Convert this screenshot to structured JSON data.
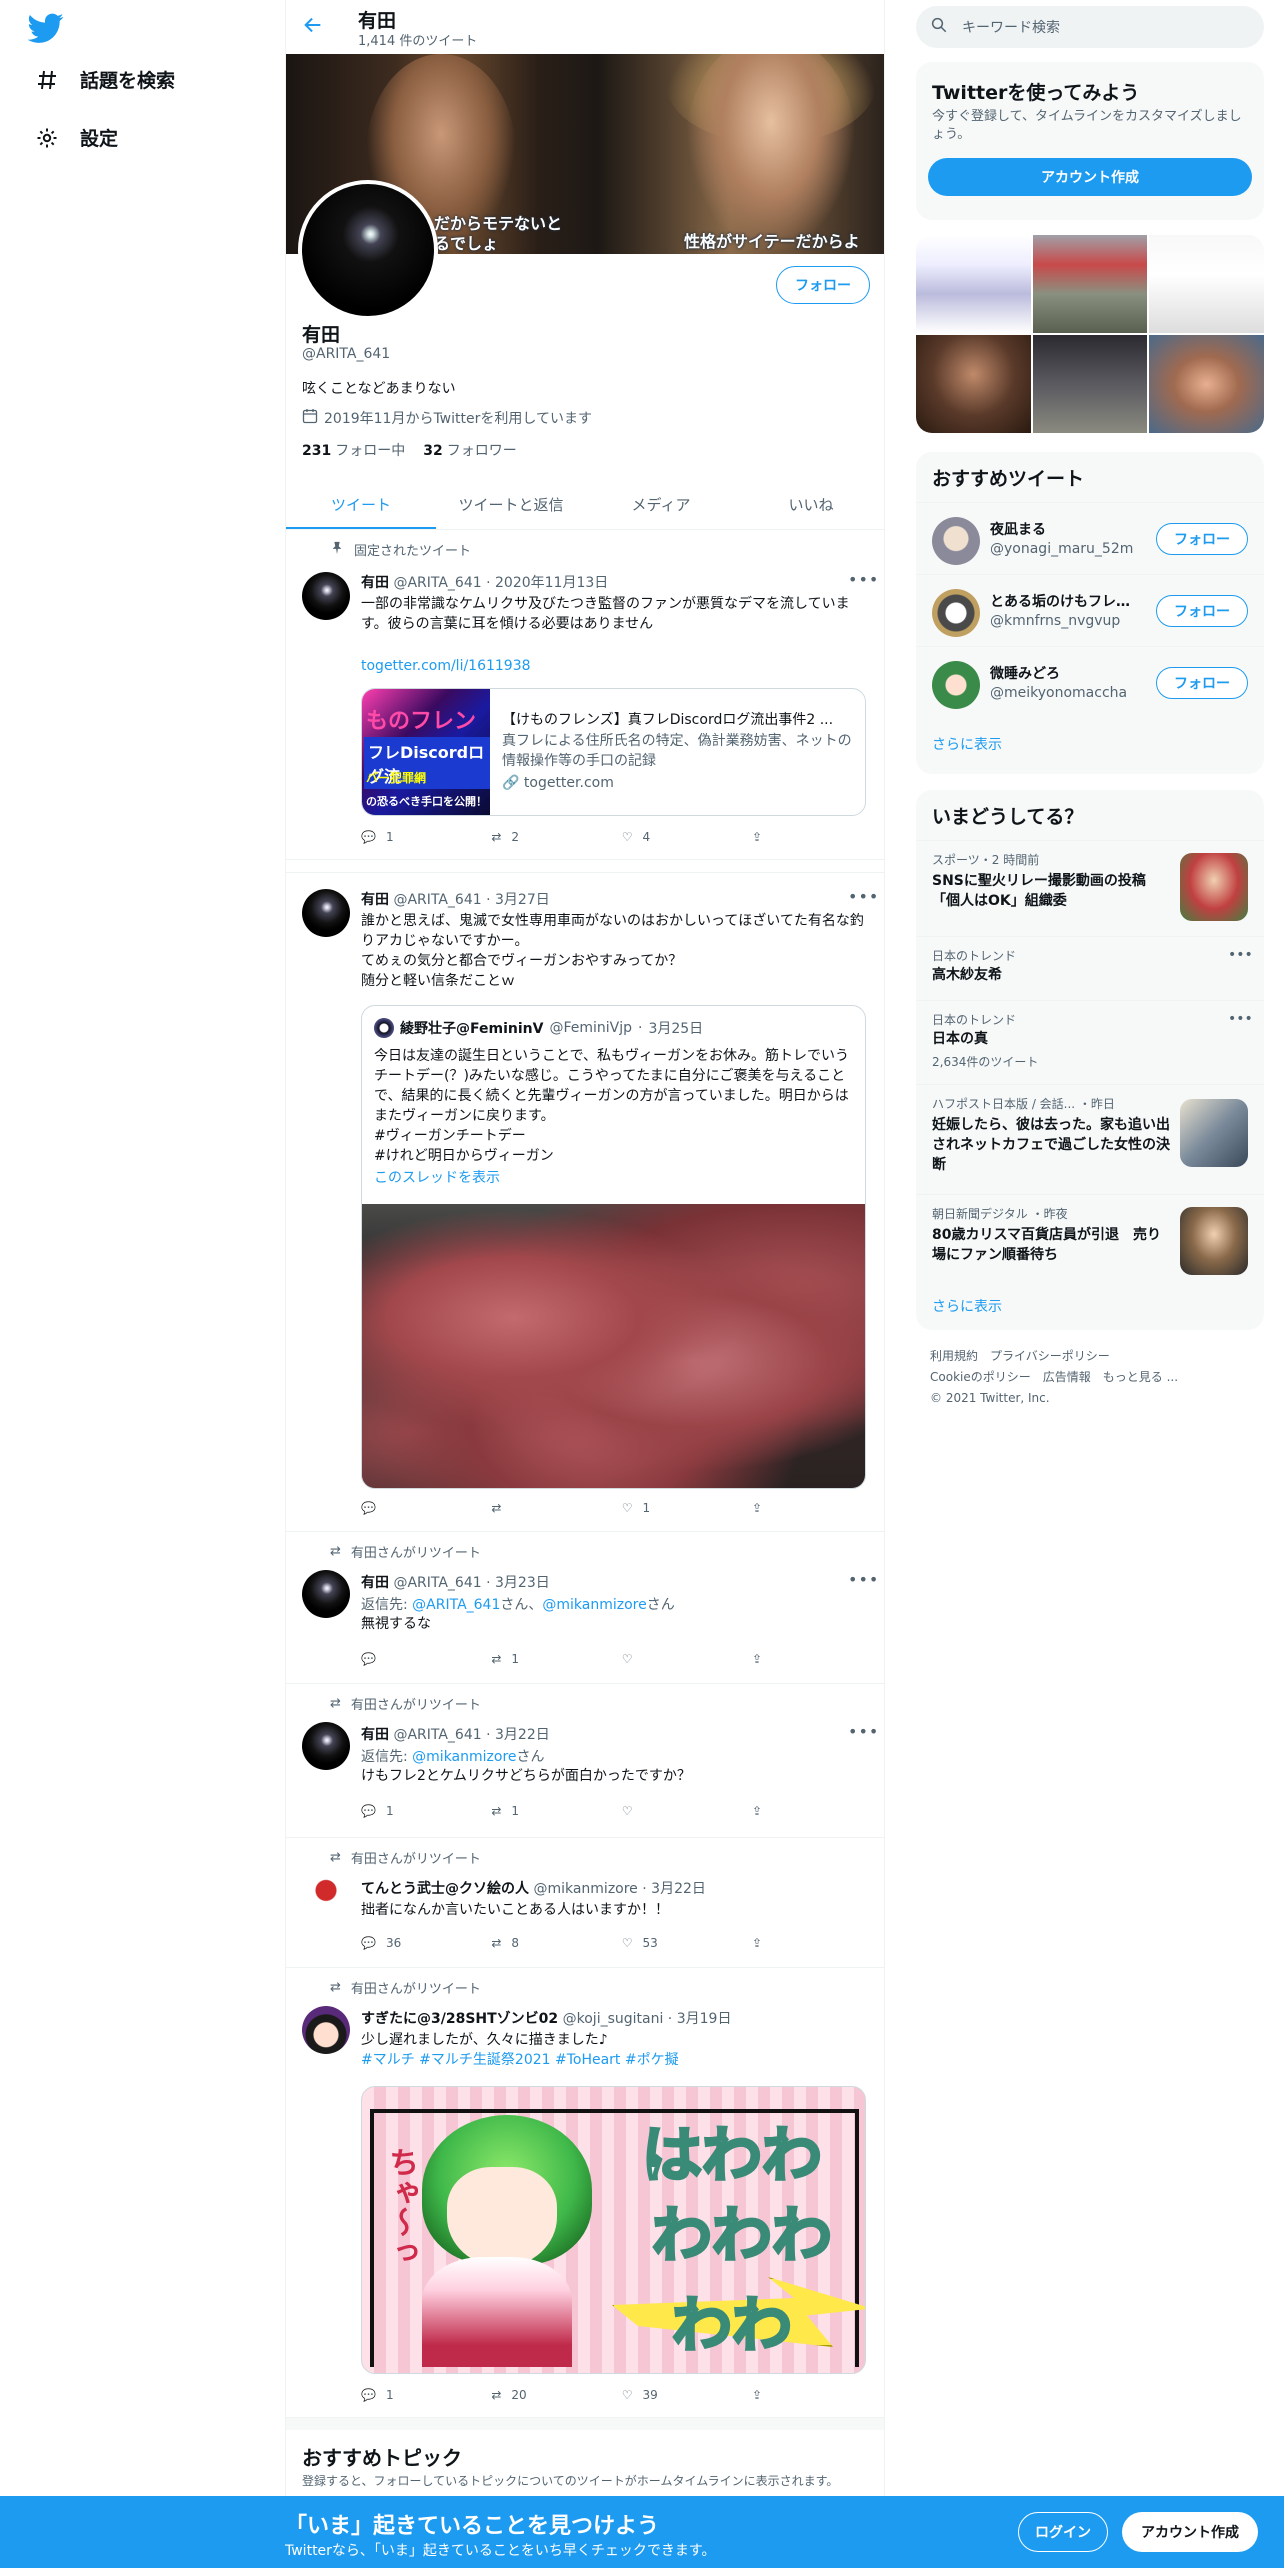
{
  "nav": {
    "explore": "話題を検索",
    "settings": "設定"
  },
  "header": {
    "name": "有田",
    "tweet_count": "1,414 件のツイート"
  },
  "banner": {
    "subtitle_left_1": "だからモテないと",
    "subtitle_left_2": "るでしょ",
    "subtitle_right": "性格がサイテーだからよ"
  },
  "profile": {
    "follow": "フォロー",
    "name": "有田",
    "handle": "@ARITA_641",
    "bio": "呟くことなどあまりない",
    "joined": "2019年11月からTwitterを利用しています",
    "following_count": "231",
    "following_label": "フォロー中",
    "followers_count": "32",
    "followers_label": "フォロワー"
  },
  "tabs": [
    "ツイート",
    "ツイートと返信",
    "メディア",
    "いいね"
  ],
  "tweets": {
    "pinned_label": "固定されたツイート",
    "t1": {
      "name": "有田",
      "handle": "@ARITA_641",
      "date": "2020年11月13日",
      "text": "一部の非常識なケムリクサ及びたつき監督のファンが悪質なデマを流しています。彼らの言葉に耳を傾ける必要はありません",
      "link": "togetter.com/li/1611938",
      "card_title": "【けものフレンズ】真フレDiscordログ流出事件2 ...",
      "card_desc": "真フレによる住所氏名の特定、偽計業務妨害、ネットの情報操作等の手口の記録",
      "card_domain": "togetter.com",
      "card_thumb_1": "ものフレンズ",
      "card_thumb_2": "フレDiscordログ流",
      "card_thumb_3": "バー犯罪網",
      "card_thumb_4": "の恐るべき手口を公開！",
      "replies": "1",
      "retweets": "2",
      "likes": "4"
    },
    "t2": {
      "name": "有田",
      "handle": "@ARITA_641",
      "date": "3月27日",
      "text": "誰かと思えば、鬼滅で女性専用車両がないのはおかしいってほざいてた有名な釣りアカじゃないですかー。\nてめぇの気分と都合でヴィーガンおやすみってか？\n随分と軽い信条だことｗ",
      "quote_name": "綾野壮子@FemininV",
      "quote_handle": "@FeminiVjp",
      "quote_date": "3月25日",
      "quote_text": "今日は友達の誕生日ということで、私もヴィーガンをお休み。筋トレでいうチートデー(？)みたいな感じ。こうやってたまに自分にご褒美を与えることで、結果的に長く続くと先輩ヴィーガンの方が言っていました。明日からはまたヴィーガンに戻ります。\n#ヴィーガンチートデー\n#けれど明日からヴィーガン",
      "quote_thread": "このスレッドを表示",
      "replies": "",
      "retweets": "",
      "likes": "1"
    },
    "retweet_label": "有田さんがリツイート",
    "t3": {
      "name": "有田",
      "handle": "@ARITA_641",
      "date": "3月23日",
      "reply_prefix": "返信先: ",
      "reply_to_1": "@ARITA_641",
      "reply_mid": "さん、",
      "reply_to_2": "@mikanmizore",
      "reply_suffix": "さん",
      "text": "無視するな",
      "replies": "",
      "retweets": "1",
      "likes": ""
    },
    "t4": {
      "name": "有田",
      "handle": "@ARITA_641",
      "date": "3月22日",
      "reply_prefix": "返信先: ",
      "reply_to": "@mikanmizore",
      "reply_suffix": "さん",
      "text": "けもフレ2とケムリクサどちらが面白かったですか？",
      "replies": "1",
      "retweets": "1",
      "likes": ""
    },
    "t5": {
      "name": "てんとう武士@クソ絵の人",
      "handle": "@mikanmizore",
      "date": "3月22日",
      "text": "拙者になんか言いたいことある人はいますか！！",
      "replies": "36",
      "retweets": "8",
      "likes": "53"
    },
    "t6": {
      "name": "すぎたに@3/28SHTゾンビ02",
      "handle": "@koji_sugitani",
      "date": "3月19日",
      "text": "少し遅れましたが、久々に描きました♪",
      "hashtags": "#マルチ #マルチ生誕祭2021 #ToHeart #ポケ擬",
      "img_text_1": "はわわ",
      "img_text_2": "わわわ",
      "img_text_3": "わわ",
      "img_cha": "ちゃ〜っ",
      "replies": "1",
      "retweets": "20",
      "likes": "39"
    }
  },
  "topics": {
    "title": "おすすめトピック",
    "subtitle": "登録すると、フォローしているトピックについてのツイートがホームタイムラインに表示されます。"
  },
  "right": {
    "search_placeholder": "キーワード検索",
    "try_title": "Twitterを使ってみよう",
    "try_desc": "今すぐ登録して、タイムラインをカスタマイズしましょう。",
    "try_button": "アカウント作成",
    "rec_title": "おすすめツイート",
    "rec": [
      {
        "name": "夜凪まる",
        "handle": "@yonagi_maru_52m",
        "button": "フォロー"
      },
      {
        "name": "とある垢のけもフレ...",
        "handle": "@kmnfrns_nvgvup",
        "button": "フォロー"
      },
      {
        "name": "微睡みどろ",
        "handle": "@meikyonomaccha",
        "button": "フォロー"
      }
    ],
    "show_more": "さらに表示",
    "trends_title": "いまどうしてる？",
    "trends": [
      {
        "category": "スポーツ・2 時間前",
        "name": "SNSに聖火リレー撮影動画の投稿「個人はOK」組織委",
        "meta": ""
      },
      {
        "category": "日本のトレンド",
        "name": "高木紗友希",
        "meta": ""
      },
      {
        "category": "日本のトレンド",
        "name": "日本の真",
        "meta": "2,634件のツイート"
      },
      {
        "category": "ハフポスト日本版 / 会話... ・昨日",
        "name": "妊娠したら、彼は去った。家も追い出されネットカフェで過ごした女性の決断",
        "meta": ""
      },
      {
        "category": "朝日新聞デジタル ・昨夜",
        "name": "80歳カリスマ百貨店員が引退　売り場にファン順番待ち",
        "meta": ""
      }
    ],
    "trends_more": "さらに表示",
    "footer_1": "利用規約",
    "footer_2": "プライバシーポリシー",
    "footer_3": "Cookieのポリシー",
    "footer_4": "広告情報",
    "footer_5": "もっと見る ...",
    "footer_6": "© 2021 Twitter, Inc."
  },
  "bottom": {
    "title": "「いま」起きていることを見つけよう",
    "subtitle": "Twitterなら、「いま」起きていることをいち早くチェックできます。",
    "login": "ログイン",
    "signup": "アカウント作成"
  },
  "colors": {
    "accent": "#1d9bf0",
    "text": "#0f1419",
    "muted": "#536471"
  }
}
